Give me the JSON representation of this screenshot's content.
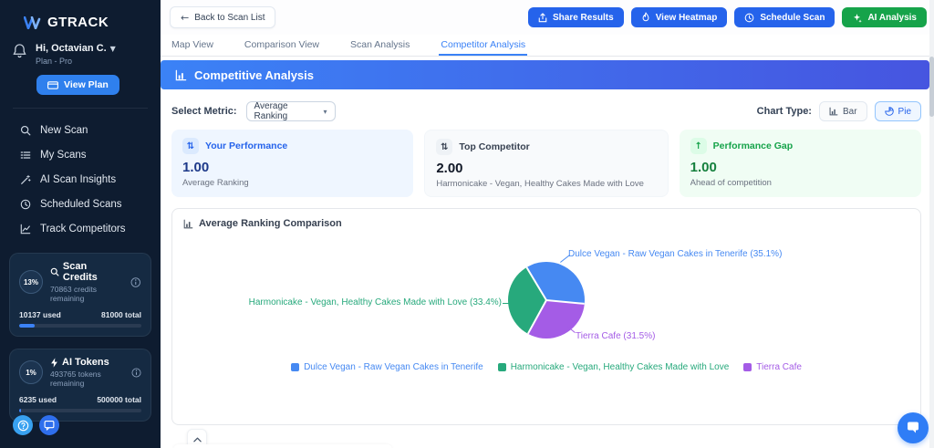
{
  "sidebar": {
    "brand": "GTRACK",
    "greeting": "Hi, Octavian C.",
    "plan": "Plan - Pro",
    "view_plan_label": "View Plan",
    "menu": [
      {
        "label": "New Scan"
      },
      {
        "label": "My Scans"
      },
      {
        "label": "AI Scan Insights"
      },
      {
        "label": "Scheduled Scans"
      },
      {
        "label": "Track Competitors"
      }
    ],
    "credits": {
      "percent": "13%",
      "title": "Scan Credits",
      "remaining": "70863 credits remaining",
      "used": "10137 used",
      "total": "81000 total",
      "used_fraction": 0.125
    },
    "tokens": {
      "percent": "1%",
      "title": "AI Tokens",
      "remaining": "493765 tokens remaining",
      "used": "6235 used",
      "total": "500000 total",
      "used_fraction": 0.0125
    }
  },
  "topbar": {
    "back_label": "Back to Scan List",
    "actions": [
      {
        "label": "Share Results",
        "color": "#2563eb"
      },
      {
        "label": "View Heatmap",
        "color": "#2563eb"
      },
      {
        "label": "Schedule Scan",
        "color": "#2563eb"
      },
      {
        "label": "AI Analysis",
        "color": "#16a34a"
      }
    ]
  },
  "tabs": [
    {
      "label": "Map View"
    },
    {
      "label": "Comparison View"
    },
    {
      "label": "Scan Analysis"
    },
    {
      "label": "Competitor Analysis"
    }
  ],
  "banner": {
    "title": "Competitive Analysis"
  },
  "controls": {
    "metric_label": "Select Metric:",
    "metric_value": "Average Ranking",
    "chart_type_label": "Chart Type:",
    "bar_label": "Bar",
    "pie_label": "Pie"
  },
  "cards": [
    {
      "title": "Your Performance",
      "value": "1.00",
      "subtitle": "Average Ranking"
    },
    {
      "title": "Top Competitor",
      "value": "2.00",
      "subtitle": "Harmonicake - Vegan, Healthy Cakes Made with Love"
    },
    {
      "title": "Performance Gap",
      "value": "1.00",
      "subtitle": "Ahead of competition"
    }
  ],
  "chart_data": {
    "type": "pie",
    "title": "Average Ranking Comparison",
    "slices": [
      {
        "name": "Dulce Vegan - Raw Vegan Cakes in Tenerife",
        "percent": 35.1,
        "color": "#4689f2",
        "callout": "Dulce Vegan - Raw Vegan Cakes in Tenerife (35.1%)"
      },
      {
        "name": "Harmonicake - Vegan, Healthy Cakes Made with Love",
        "percent": 33.4,
        "color": "#27a97c",
        "callout": "Harmonicake - Vegan, Healthy Cakes Made with Love (33.4%)"
      },
      {
        "name": "Tierra Cafe",
        "percent": 31.5,
        "color": "#a45ce6",
        "callout": "Tierra Cafe (31.5%)"
      }
    ],
    "rotation_deg": -31,
    "clockwise_order": [
      0,
      2,
      1
    ],
    "legend_position": "bottom"
  }
}
